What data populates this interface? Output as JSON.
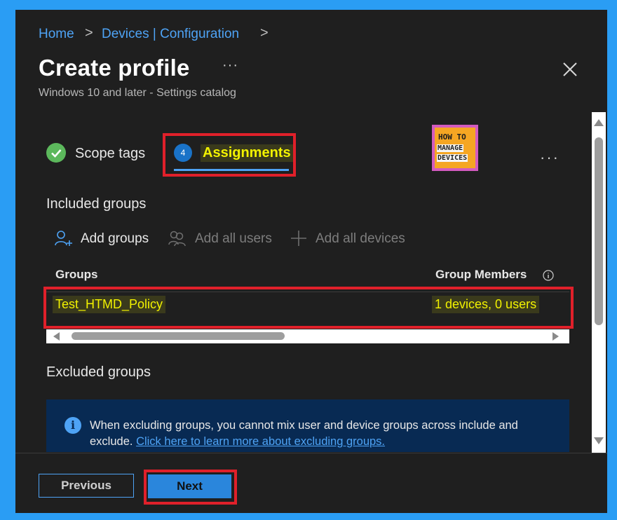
{
  "breadcrumb": {
    "home": "Home",
    "devices": "Devices | Configuration",
    "sep": ">"
  },
  "header": {
    "title": "Create profile",
    "more": "···",
    "subtitle": "Windows 10 and later - Settings catalog",
    "close_icon": "close-icon"
  },
  "tabs": {
    "scope_tags": {
      "label": "Scope tags",
      "icon": "check-circle-icon"
    },
    "assignments": {
      "step": "4",
      "label": "Assignments"
    }
  },
  "logo": {
    "line1": "HOW TO",
    "line2": "MANAGE",
    "line3": "DEVICES"
  },
  "more_options": "···",
  "included": {
    "heading": "Included groups",
    "toolbar": {
      "add_groups": "Add groups",
      "add_all_users": "Add all users",
      "add_all_devices": "Add all devices"
    },
    "columns": {
      "groups": "Groups",
      "members": "Group Members"
    },
    "rows": [
      {
        "group": "Test_HTMD_Policy",
        "members": "1 devices, 0 users"
      }
    ]
  },
  "excluded": {
    "heading": "Excluded groups",
    "info_text": "When excluding groups, you cannot mix user and device groups across include and exclude.",
    "info_link": "Click here to learn more about excluding groups."
  },
  "footer": {
    "previous": "Previous",
    "next": "Next"
  },
  "colors": {
    "accent": "#4ea3f5",
    "highlight": "#f2f200",
    "annotation_red": "#e0202a",
    "panel_bg": "#1f1f1f",
    "frame": "#2a9df4"
  }
}
